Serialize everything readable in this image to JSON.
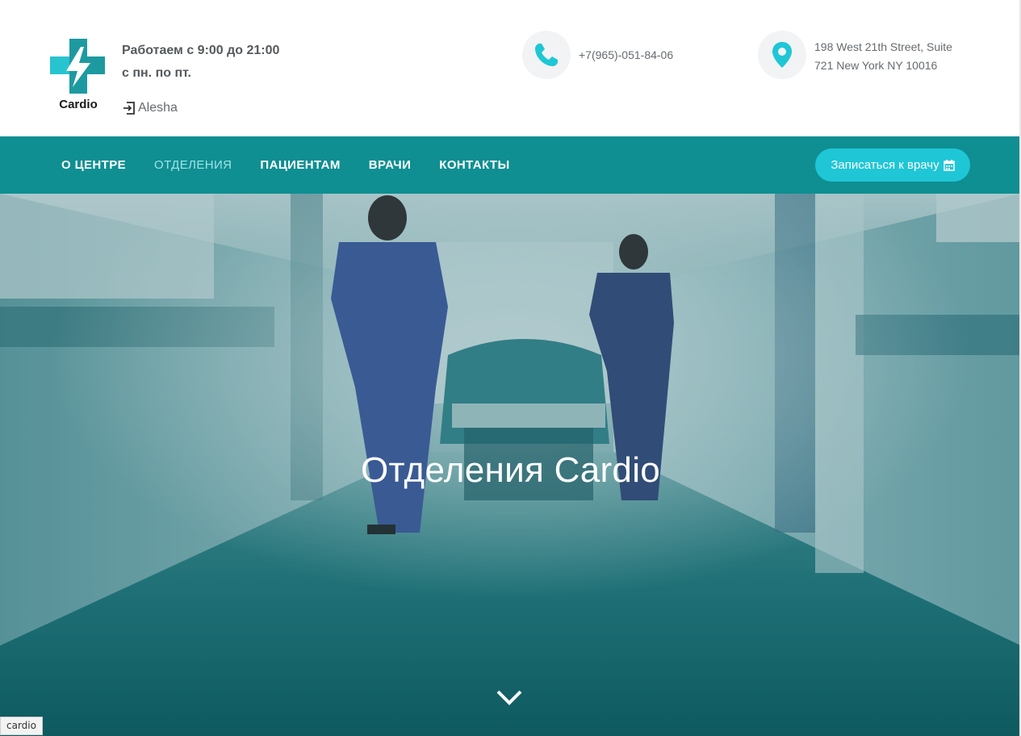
{
  "brand": {
    "name": "Cardio",
    "primary_color": "#0f8f92",
    "accent_color": "#1fc6d6"
  },
  "header": {
    "hours_line1": "Работаем с 9:00 до 21:00",
    "hours_line2": "с пн. по пт.",
    "user_icon": "sign-in-icon",
    "user_name": "Alesha",
    "phone_icon": "phone-icon",
    "phone": "+7(965)-051-84-06",
    "address_icon": "map-marker-icon",
    "address_line1": "198 West 21th Street, Suite",
    "address_line2": "721 New York NY 10016"
  },
  "nav": {
    "items": [
      {
        "label": "О ЦЕНТРЕ"
      },
      {
        "label": "ОТДЕЛЕНИЯ",
        "active": true
      },
      {
        "label": "ПАЦИЕНТАМ"
      },
      {
        "label": "ВРАЧИ"
      },
      {
        "label": "КОНТАКТЫ"
      }
    ],
    "cta_label": "Записаться к врачу",
    "cta_icon": "calendar-icon"
  },
  "hero": {
    "title": "Отделения Cardio",
    "scroll_icon": "chevron-down-icon"
  },
  "status": {
    "tag": "cardio"
  }
}
